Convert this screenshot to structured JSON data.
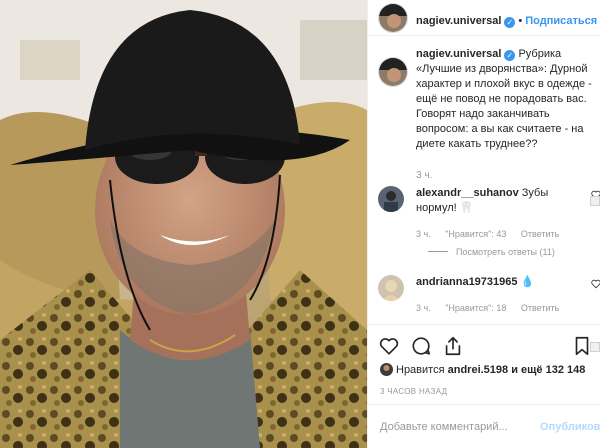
{
  "post": {
    "username": "nagiev.universal",
    "follow_label": "Подписаться",
    "caption_text": "Рубрика «Лучшие из дворянства»: Дурной характер и плохой вкус в одежде - ещё не повод не порадовать вас. Говорят надо заканчивать вопросом: а вы как считаете - на диете какать труднее??",
    "caption_time": "3 ч."
  },
  "comments": [
    {
      "username": "alexandr__suhanov",
      "text": "Зубы нормул! 🦷",
      "time": "3 ч.",
      "likes_label": "\"Нравится\": 43",
      "reply_label": "Ответить",
      "view_replies": "Посмотреть ответы (11)"
    },
    {
      "username": "andrianna19731965",
      "text": "💧",
      "time": "3 ч.",
      "likes_label": "\"Нравится\": 18",
      "reply_label": "Ответить"
    }
  ],
  "likes": {
    "prefix": "Нравится",
    "user": "andrei.5198",
    "suffix": "и ещё 132 148"
  },
  "time_ago": "3 ЧАСОВ НАЗАД",
  "add_comment": {
    "placeholder": "Добавьте комментарий...",
    "publish_label": "Опубликовать"
  },
  "icons": [
    "heart-icon",
    "comment-icon",
    "share-icon",
    "bookmark-icon",
    "verified-icon"
  ],
  "colors": {
    "accent": "#3897f0",
    "muted": "#999999",
    "border": "#efefef",
    "publish_disabled": "#b3dbff"
  }
}
